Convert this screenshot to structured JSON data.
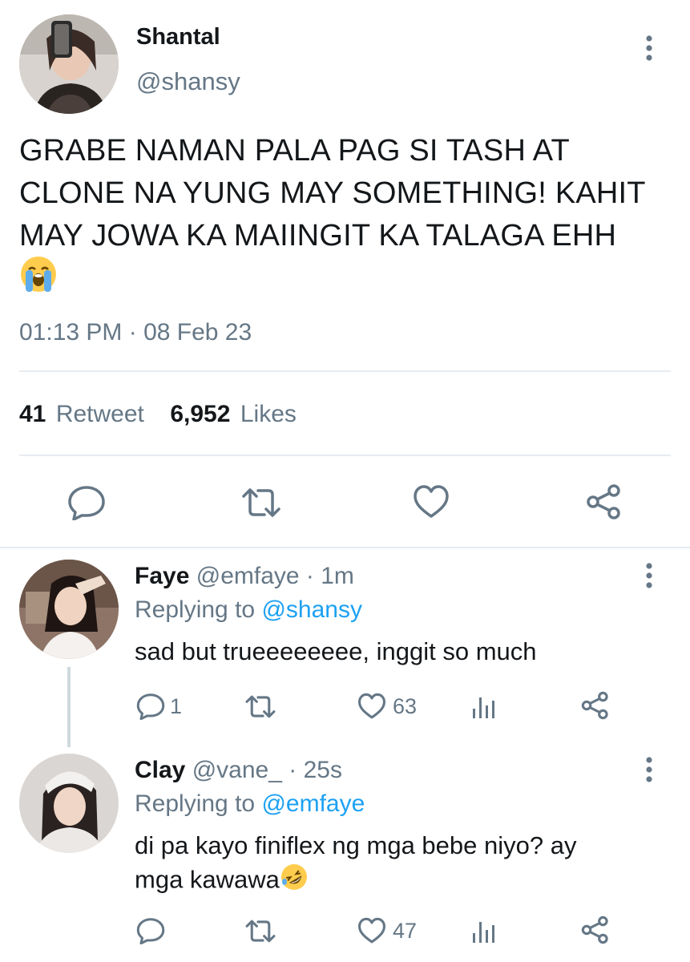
{
  "main_tweet": {
    "author_name": "Shantal",
    "author_handle": "@shansy",
    "text_lines": [
      "GRABE NAMAN PALA PAG SI TASH AT",
      "CLONE NA YUNG MAY SOMETHING! KAHIT",
      "MAY JOWA KA MAIINGIT KA TALAGA EHH"
    ],
    "emoji": "loudly-crying-face",
    "timestamp": "01:13 PM · 08 Feb 23",
    "retweet_count": "41",
    "retweet_label": "Retweet",
    "likes_count": "6,952",
    "likes_label": "Likes",
    "actions": [
      "reply-icon",
      "retweet-icon",
      "like-icon",
      "share-icon"
    ]
  },
  "replies": [
    {
      "name": "Faye",
      "handle": "@emfaye",
      "time": "· 1m",
      "replying_label": "Replying to",
      "replying_to": "@shansy",
      "text": "sad but trueeeeeeee, inggit so much",
      "reply_count": "1",
      "like_count": "63"
    },
    {
      "name": "Clay",
      "handle": "@vane_",
      "time": "· 25s",
      "replying_label": "Replying to",
      "replying_to": "@emfaye",
      "text_line1": "di pa kayo finiflex ng mga bebe niyo? ay",
      "text_line2": "mga kawawa",
      "emoji": "rolling-on-floor-laughing",
      "reply_count": "",
      "like_count": "47"
    }
  ],
  "colors": {
    "muted": "#657786",
    "link": "#1da1f2",
    "divider": "#e6ecf0",
    "text": "#14171a"
  }
}
